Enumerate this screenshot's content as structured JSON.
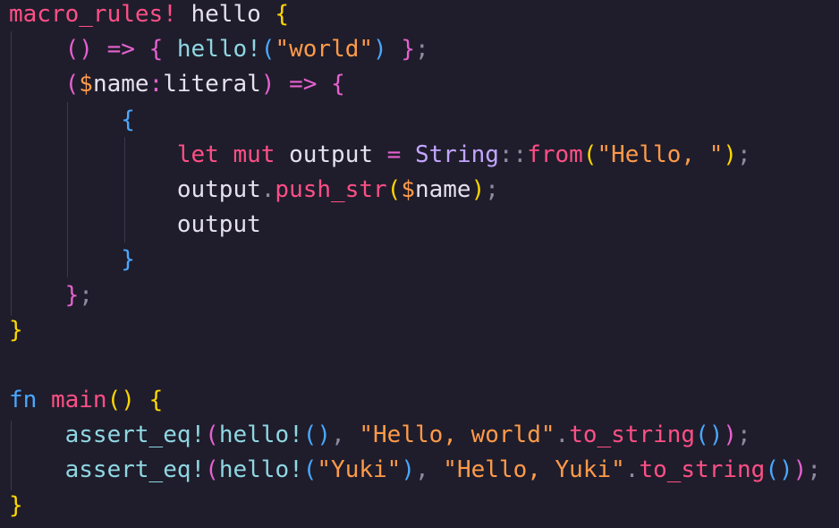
{
  "colors": {
    "background": "#1f1d2b",
    "keyword": "#ff4f86",
    "plain": "#e6e1ef",
    "function": "#ff4f86",
    "macro_call": "#8fd7e3",
    "string": "#ff9a4a",
    "bracket_yellow": "#ffd700",
    "bracket_pink": "#e661d0",
    "bracket_blue": "#4aa8ff",
    "operator": "#e661d0",
    "type": "#c3a6ff",
    "punct": "#8e8aa0",
    "dollar": "#ff9a4a"
  },
  "code": {
    "lines": [
      {
        "tokens": [
          {
            "t": "macro_rules!",
            "c": "#ff4f86"
          },
          {
            "t": " hello ",
            "c": "#e6e1ef"
          },
          {
            "t": "{",
            "c": "#ffd700"
          }
        ]
      },
      {
        "tokens": [
          {
            "t": "    ",
            "c": "#e6e1ef"
          },
          {
            "t": "()",
            "c": "#e661d0"
          },
          {
            "t": " ",
            "c": "#e6e1ef"
          },
          {
            "t": "=>",
            "c": "#e661d0"
          },
          {
            "t": " ",
            "c": "#e6e1ef"
          },
          {
            "t": "{",
            "c": "#e661d0"
          },
          {
            "t": " hello!",
            "c": "#8fd7e3"
          },
          {
            "t": "(",
            "c": "#4aa8ff"
          },
          {
            "t": "\"world\"",
            "c": "#ff9a4a"
          },
          {
            "t": ")",
            "c": "#4aa8ff"
          },
          {
            "t": " ",
            "c": "#e6e1ef"
          },
          {
            "t": "}",
            "c": "#e661d0"
          },
          {
            "t": ";",
            "c": "#8e8aa0"
          }
        ]
      },
      {
        "tokens": [
          {
            "t": "    ",
            "c": "#e6e1ef"
          },
          {
            "t": "(",
            "c": "#e661d0"
          },
          {
            "t": "$",
            "c": "#ff9a4a"
          },
          {
            "t": "name",
            "c": "#e6e1ef"
          },
          {
            "t": ":",
            "c": "#e661d0"
          },
          {
            "t": "literal",
            "c": "#e6e1ef"
          },
          {
            "t": ")",
            "c": "#e661d0"
          },
          {
            "t": " ",
            "c": "#e6e1ef"
          },
          {
            "t": "=>",
            "c": "#e661d0"
          },
          {
            "t": " ",
            "c": "#e6e1ef"
          },
          {
            "t": "{",
            "c": "#e661d0"
          }
        ]
      },
      {
        "tokens": [
          {
            "t": "        ",
            "c": "#e6e1ef"
          },
          {
            "t": "{",
            "c": "#4aa8ff"
          }
        ]
      },
      {
        "tokens": [
          {
            "t": "            ",
            "c": "#e6e1ef"
          },
          {
            "t": "let",
            "c": "#ff4f86"
          },
          {
            "t": " ",
            "c": "#e6e1ef"
          },
          {
            "t": "mut",
            "c": "#ff4f86"
          },
          {
            "t": " output ",
            "c": "#e6e1ef"
          },
          {
            "t": "=",
            "c": "#e661d0"
          },
          {
            "t": " ",
            "c": "#e6e1ef"
          },
          {
            "t": "String",
            "c": "#c3a6ff"
          },
          {
            "t": "::",
            "c": "#8e8aa0"
          },
          {
            "t": "from",
            "c": "#ff4f86"
          },
          {
            "t": "(",
            "c": "#ffd700"
          },
          {
            "t": "\"Hello, \"",
            "c": "#ff9a4a"
          },
          {
            "t": ")",
            "c": "#ffd700"
          },
          {
            "t": ";",
            "c": "#8e8aa0"
          }
        ]
      },
      {
        "tokens": [
          {
            "t": "            ",
            "c": "#e6e1ef"
          },
          {
            "t": "output",
            "c": "#e6e1ef"
          },
          {
            "t": ".",
            "c": "#8e8aa0"
          },
          {
            "t": "push_str",
            "c": "#ff4f86"
          },
          {
            "t": "(",
            "c": "#ffd700"
          },
          {
            "t": "$",
            "c": "#ff9a4a"
          },
          {
            "t": "name",
            "c": "#e6e1ef"
          },
          {
            "t": ")",
            "c": "#ffd700"
          },
          {
            "t": ";",
            "c": "#8e8aa0"
          }
        ]
      },
      {
        "tokens": [
          {
            "t": "            ",
            "c": "#e6e1ef"
          },
          {
            "t": "output",
            "c": "#e6e1ef"
          }
        ]
      },
      {
        "tokens": [
          {
            "t": "        ",
            "c": "#e6e1ef"
          },
          {
            "t": "}",
            "c": "#4aa8ff"
          }
        ]
      },
      {
        "tokens": [
          {
            "t": "    ",
            "c": "#e6e1ef"
          },
          {
            "t": "}",
            "c": "#e661d0"
          },
          {
            "t": ";",
            "c": "#8e8aa0"
          }
        ]
      },
      {
        "tokens": [
          {
            "t": "}",
            "c": "#ffd700"
          }
        ]
      },
      {
        "tokens": [
          {
            "t": "",
            "c": "#e6e1ef"
          }
        ]
      },
      {
        "tokens": [
          {
            "t": "fn",
            "c": "#4aa8ff"
          },
          {
            "t": " ",
            "c": "#e6e1ef"
          },
          {
            "t": "main",
            "c": "#ff4f86"
          },
          {
            "t": "()",
            "c": "#ffd700"
          },
          {
            "t": " ",
            "c": "#e6e1ef"
          },
          {
            "t": "{",
            "c": "#ffd700"
          }
        ]
      },
      {
        "tokens": [
          {
            "t": "    ",
            "c": "#e6e1ef"
          },
          {
            "t": "assert_eq!",
            "c": "#8fd7e3"
          },
          {
            "t": "(",
            "c": "#e661d0"
          },
          {
            "t": "hello!",
            "c": "#8fd7e3"
          },
          {
            "t": "()",
            "c": "#4aa8ff"
          },
          {
            "t": ",",
            "c": "#8e8aa0"
          },
          {
            "t": " ",
            "c": "#e6e1ef"
          },
          {
            "t": "\"Hello, world\"",
            "c": "#ff9a4a"
          },
          {
            "t": ".",
            "c": "#8e8aa0"
          },
          {
            "t": "to_string",
            "c": "#ff4f86"
          },
          {
            "t": "()",
            "c": "#4aa8ff"
          },
          {
            "t": ")",
            "c": "#e661d0"
          },
          {
            "t": ";",
            "c": "#8e8aa0"
          }
        ]
      },
      {
        "tokens": [
          {
            "t": "    ",
            "c": "#e6e1ef"
          },
          {
            "t": "assert_eq!",
            "c": "#8fd7e3"
          },
          {
            "t": "(",
            "c": "#e661d0"
          },
          {
            "t": "hello!",
            "c": "#8fd7e3"
          },
          {
            "t": "(",
            "c": "#4aa8ff"
          },
          {
            "t": "\"Yuki\"",
            "c": "#ff9a4a"
          },
          {
            "t": ")",
            "c": "#4aa8ff"
          },
          {
            "t": ",",
            "c": "#8e8aa0"
          },
          {
            "t": " ",
            "c": "#e6e1ef"
          },
          {
            "t": "\"Hello, Yuki\"",
            "c": "#ff9a4a"
          },
          {
            "t": ".",
            "c": "#8e8aa0"
          },
          {
            "t": "to_string",
            "c": "#ff4f86"
          },
          {
            "t": "()",
            "c": "#4aa8ff"
          },
          {
            "t": ")",
            "c": "#e661d0"
          },
          {
            "t": ";",
            "c": "#8e8aa0"
          }
        ]
      },
      {
        "tokens": [
          {
            "t": "}",
            "c": "#ffd700"
          }
        ]
      }
    ]
  }
}
